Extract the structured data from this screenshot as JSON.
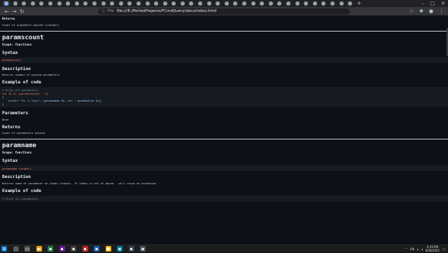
{
  "browser": {
    "tabs_count": 40,
    "active_tab_index": 0,
    "new_tab_label": "+",
    "window_controls": {
      "minimize": "–",
      "maximize": "□",
      "close": "✕"
    },
    "address_label": "File",
    "url": "file:///E:/PortedProjects/FCmdQuery/docs/index.html"
  },
  "doc": {
    "top_returns_heading": "Returns",
    "top_returns_text": "Count of arguments passed (integer)",
    "sections": [
      {
        "title": "paramscount",
        "scope": "Scope: functions",
        "syntax_heading": "Syntax",
        "syntax_code": "paramscount;",
        "description_heading": "Description",
        "description": "Returns number of passed parameters",
        "example_heading": "Example of code",
        "example_lines": [
          "% Print all parameters",
          "for $i 0, {paramscount} - 1}",
          "{",
          "    printf \"%s := %s\\n\", {paramname $i; str : paramvalue $i};",
          "}"
        ],
        "parameters_heading": "Parameters",
        "parameters": "None",
        "returns_heading": "Returns",
        "returns": "Count of parameters passed"
      },
      {
        "title": "paramname",
        "scope": "Scope: functions",
        "syntax_heading": "Syntax",
        "syntax_code": "paramname <index>;",
        "description_heading": "Description",
        "description": "Returns name of parameter on index <index>. If index is out of bound - will raise an exception",
        "example_heading": "Example of code",
        "example_first_line": "% Print all parameters"
      }
    ]
  },
  "taskbar": {
    "tray_lang": "EN",
    "time": "9:59 PM",
    "date": "8/28/2021"
  }
}
